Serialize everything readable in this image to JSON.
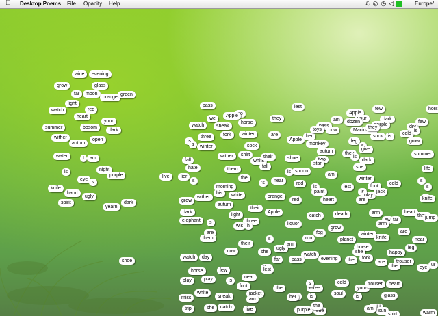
{
  "menubar": {
    "app_name": "Desktop Poems",
    "menus": [
      "File",
      "Opacity",
      "Help"
    ],
    "apple_icon": "apple-logo-icon",
    "status_icons": [
      "script-icon",
      "globe-icon",
      "timemachine-icon",
      "volume-icon",
      "green-square-icon"
    ],
    "region_text": "Europe/..."
  },
  "magnets": [
    [
      "wine",
      105,
      108
    ],
    [
      "evening",
      130,
      108
    ],
    [
      "grow",
      79,
      125
    ],
    [
      "glass",
      134,
      125
    ],
    [
      "far",
      104,
      137
    ],
    [
      "moon",
      121,
      137
    ],
    [
      "orange",
      146,
      142
    ],
    [
      "green",
      172,
      138
    ],
    [
      "light",
      95,
      151
    ],
    [
      "red",
      124,
      160
    ],
    [
      "heart",
      108,
      170
    ],
    [
      "your",
      148,
      177
    ],
    [
      "watch",
      71,
      161
    ],
    [
      "summer",
      62,
      186
    ],
    [
      "bosom",
      117,
      186
    ],
    [
      "dark",
      155,
      190
    ],
    [
      "wither",
      75,
      201
    ],
    [
      "open",
      131,
      204
    ],
    [
      "autum",
      101,
      209
    ],
    [
      "water",
      78,
      228
    ],
    [
      "I",
      117,
      231
    ],
    [
      "am",
      127,
      231
    ],
    [
      "night",
      141,
      248
    ],
    [
      "is",
      90,
      251
    ],
    [
      "purple",
      156,
      256
    ],
    [
      "eye",
      113,
      262
    ],
    [
      "s",
      130,
      266
    ],
    [
      "knife",
      70,
      275
    ],
    [
      "hand",
      94,
      282
    ],
    [
      "ugly",
      120,
      287
    ],
    [
      "spirit",
      85,
      296
    ],
    [
      "dark",
      177,
      296
    ],
    [
      "yearn",
      150,
      302
    ],
    [
      "shoe",
      174,
      381
    ],
    [
      "pass",
      292,
      154
    ],
    [
      "go",
      343,
      166
    ],
    [
      "we",
      302,
      173
    ],
    [
      "Apple",
      326,
      169
    ],
    [
      "horse",
      348,
      179
    ],
    [
      "watch",
      276,
      183
    ],
    [
      "sneak",
      312,
      184
    ],
    [
      "three",
      289,
      200
    ],
    [
      "fork",
      322,
      197
    ],
    [
      "winter",
      349,
      196
    ],
    [
      "is",
      270,
      206
    ],
    [
      "s",
      276,
      211
    ],
    [
      "winter",
      288,
      214
    ],
    [
      "sock",
      357,
      213
    ],
    [
      "fall",
      266,
      234
    ],
    [
      "wither",
      318,
      228
    ],
    [
      "shirt",
      348,
      226
    ],
    [
      "white",
      366,
      235
    ],
    [
      "their",
      381,
      229
    ],
    [
      "hate",
      271,
      245
    ],
    [
      "them",
      328,
      247
    ],
    [
      "fall",
      379,
      243
    ],
    [
      "live",
      233,
      258
    ],
    [
      "lier",
      260,
      258
    ],
    [
      "s",
      277,
      264
    ],
    [
      "the",
      348,
      260
    ],
    [
      "morning",
      312,
      273
    ],
    [
      "his",
      312,
      282
    ],
    [
      "white",
      334,
      285
    ],
    [
      "grow",
      261,
      293
    ],
    [
      "wither",
      284,
      288
    ],
    [
      "autum",
      314,
      299
    ],
    [
      "dark",
      263,
      310
    ],
    [
      "light",
      334,
      314
    ],
    [
      "elephant",
      262,
      322
    ],
    [
      "three",
      355,
      323
    ],
    [
      "s",
      302,
      325
    ],
    [
      "are",
      298,
      340
    ],
    [
      "them",
      292,
      348
    ],
    [
      "cow",
      328,
      367
    ],
    [
      "watch",
      263,
      376
    ],
    [
      "day",
      291,
      376
    ],
    [
      "horse",
      275,
      396
    ],
    [
      "few",
      317,
      395
    ],
    [
      "play",
      263,
      410
    ],
    [
      "play",
      294,
      408
    ],
    [
      "is",
      330,
      410
    ],
    [
      "near",
      353,
      405
    ],
    [
      "foot",
      346,
      418
    ],
    [
      "miss",
      261,
      435
    ],
    [
      "white",
      284,
      428
    ],
    [
      "sneak",
      314,
      433
    ],
    [
      "jacket",
      360,
      429
    ],
    [
      "the",
      399,
      421
    ],
    [
      "trip",
      266,
      451
    ],
    [
      "she",
      298,
      450
    ],
    [
      "catch",
      318,
      449
    ],
    [
      "live",
      355,
      452
    ],
    [
      "am",
      360,
      437
    ],
    [
      "their",
      348,
      356
    ],
    [
      "she",
      377,
      368
    ],
    [
      "wis",
      341,
      330
    ],
    [
      "h",
      357,
      330
    ],
    [
      "they",
      394,
      173
    ],
    [
      "are",
      392,
      197
    ],
    [
      "lest",
      426,
      156
    ],
    [
      "Apple",
      419,
      204
    ],
    [
      "her",
      443,
      199
    ],
    [
      "monkey",
      447,
      210
    ],
    [
      "autum",
      463,
      221
    ],
    [
      "two",
      461,
      233
    ],
    [
      "shoe",
      416,
      231
    ],
    [
      "star",
      454,
      239
    ],
    [
      "is",
      416,
      251
    ],
    [
      "spoon",
      427,
      250
    ],
    [
      "am",
      475,
      255
    ],
    [
      "near",
      396,
      264
    ],
    [
      "red",
      429,
      268
    ],
    [
      "'s",
      378,
      267
    ],
    [
      "is",
      454,
      273
    ],
    [
      "paint",
      455,
      280
    ],
    [
      "heart",
      468,
      292
    ],
    [
      "orange",
      387,
      287
    ],
    [
      "red",
      423,
      292
    ],
    [
      "their",
      362,
      304
    ],
    [
      "Apple",
      387,
      310
    ],
    [
      "catch",
      448,
      315
    ],
    [
      "death",
      486,
      313
    ],
    [
      "liquor",
      416,
      327
    ],
    [
      "grow",
      479,
      333
    ],
    [
      "fog",
      458,
      340
    ],
    [
      "run",
      442,
      348
    ],
    [
      "s",
      388,
      349
    ],
    [
      "am",
      415,
      357
    ],
    [
      "ugly",
      400,
      363
    ],
    [
      "watch",
      440,
      372
    ],
    [
      "far",
      397,
      379
    ],
    [
      "pass",
      422,
      379
    ],
    [
      "evening",
      465,
      378
    ],
    [
      "the",
      381,
      391
    ],
    [
      "lest",
      381,
      394
    ],
    [
      "three",
      448,
      421
    ],
    [
      "cold",
      489,
      413
    ],
    [
      "your",
      518,
      421
    ],
    [
      "trouser",
      533,
      415
    ],
    [
      "heart",
      564,
      415
    ],
    [
      "the",
      423,
      433
    ],
    [
      "her",
      419,
      434
    ],
    [
      "is",
      449,
      433
    ],
    [
      "soul",
      484,
      429
    ],
    [
      "is",
      516,
      433
    ],
    [
      "glass",
      557,
      432
    ],
    [
      "purple",
      430,
      453
    ],
    [
      "she",
      458,
      454
    ],
    [
      "the",
      454,
      447
    ],
    [
      "cold",
      539,
      449
    ],
    [
      "sun",
      549,
      454
    ],
    [
      "shirt",
      563,
      459
    ],
    [
      "warm",
      614,
      457
    ],
    [
      "am",
      532,
      451
    ],
    [
      "s",
      447,
      414
    ],
    [
      "pass",
      462,
      184
    ],
    [
      "toys",
      453,
      189
    ],
    [
      "cow",
      476,
      190
    ],
    [
      "am",
      483,
      175
    ],
    [
      "Apple",
      506,
      165
    ],
    [
      "your",
      518,
      173
    ],
    [
      "dozen",
      503,
      178
    ],
    [
      "dark",
      555,
      174
    ],
    [
      "purple",
      543,
      182
    ],
    [
      "Macintosh",
      512,
      190
    ],
    [
      "they",
      534,
      186
    ],
    [
      "few",
      544,
      159
    ],
    [
      "sock",
      541,
      199
    ],
    [
      "is",
      563,
      199
    ],
    [
      "cold",
      584,
      195
    ],
    [
      "dry",
      594,
      185
    ],
    [
      "few",
      607,
      178
    ],
    [
      "is",
      601,
      191
    ],
    [
      "grow",
      594,
      206
    ],
    [
      "leg",
      509,
      206
    ],
    [
      "s",
      524,
      213
    ],
    [
      "give",
      524,
      218
    ],
    [
      "they",
      500,
      224
    ],
    [
      "is",
      512,
      229
    ],
    [
      "dark",
      525,
      234
    ],
    [
      "she",
      516,
      244
    ],
    [
      "summer",
      601,
      225
    ],
    [
      "life",
      616,
      246
    ],
    [
      "horse",
      622,
      159
    ],
    [
      "winter",
      520,
      261
    ],
    [
      "foot",
      537,
      272
    ],
    [
      "cold",
      565,
      268
    ],
    [
      "s",
      610,
      264
    ],
    [
      "s",
      619,
      273
    ],
    [
      "is",
      523,
      280
    ],
    [
      "play",
      528,
      285
    ],
    [
      "jack",
      546,
      280
    ],
    [
      "s",
      616,
      288
    ],
    [
      "knife",
      613,
      290
    ],
    [
      "are",
      520,
      292
    ],
    [
      "arm",
      539,
      311
    ],
    [
      "heart",
      587,
      310
    ],
    [
      "them",
      606,
      315
    ],
    [
      "jump",
      617,
      318
    ],
    [
      "ew",
      558,
      321
    ],
    [
      "far",
      570,
      321
    ],
    [
      "arm",
      549,
      327
    ],
    [
      "near",
      602,
      350
    ],
    [
      "winter",
      523,
      342
    ],
    [
      "knife",
      546,
      347
    ],
    [
      "are",
      581,
      338
    ],
    [
      "planet",
      493,
      350
    ],
    [
      "horse",
      517,
      361
    ],
    [
      "she",
      515,
      368
    ],
    [
      "happy",
      565,
      369
    ],
    [
      "leg",
      592,
      362
    ],
    [
      "the",
      504,
      380
    ],
    [
      "fork",
      525,
      377
    ],
    [
      "are",
      548,
      383
    ],
    [
      "trouser",
      575,
      382
    ],
    [
      "the",
      567,
      389
    ],
    [
      "eye",
      609,
      391
    ],
    [
      "ur",
      626,
      387
    ],
    [
      "lest",
      498,
      273
    ]
  ]
}
